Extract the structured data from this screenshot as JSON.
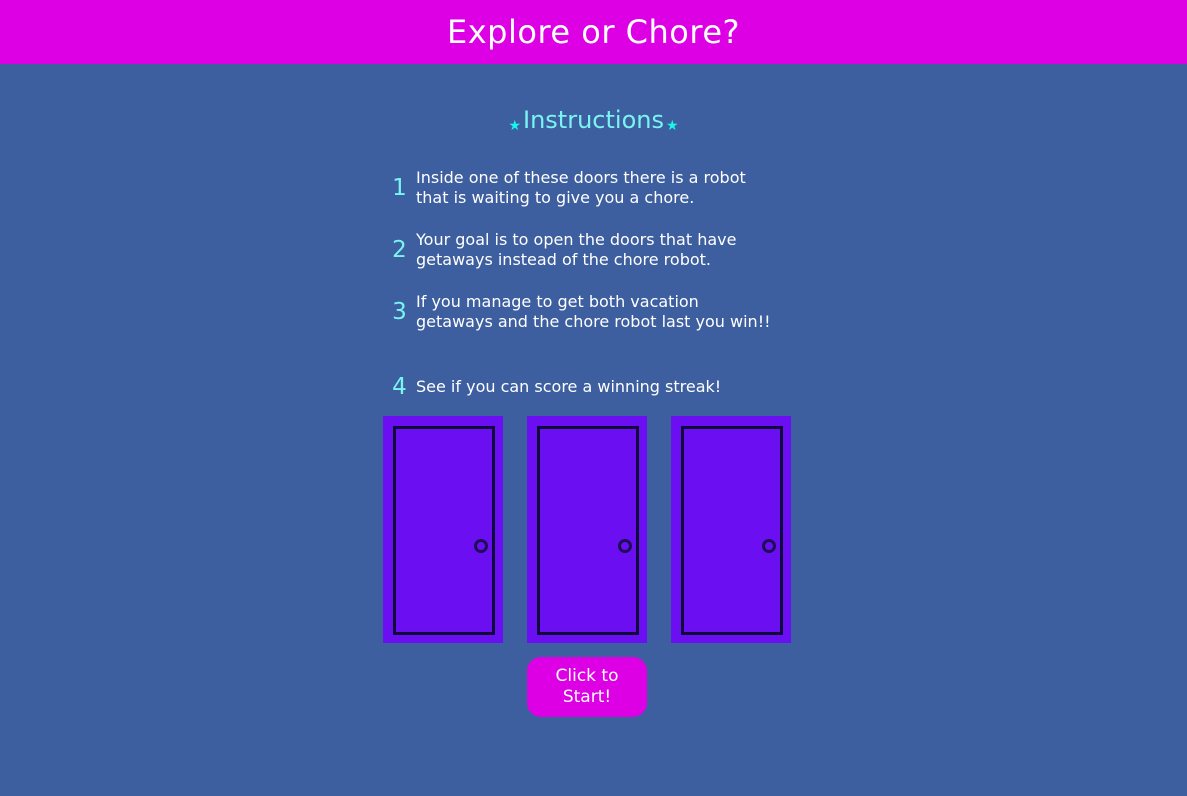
{
  "header": {
    "title": "Explore or Chore?"
  },
  "instructions": {
    "heading": "Instructions",
    "steps": [
      {
        "number": "1",
        "text": "Inside one of these doors there is a robot that is waiting to give you a chore."
      },
      {
        "number": "2",
        "text": "Your goal is to open the doors that have getaways instead of the chore robot."
      },
      {
        "number": "3",
        "text": "If you manage to get both vacation getaways and the chore robot last you win!!"
      },
      {
        "number": "4",
        "text": "See if you can score a winning streak!"
      }
    ]
  },
  "doors": [
    {
      "icon": "door-icon"
    },
    {
      "icon": "door-icon"
    },
    {
      "icon": "door-icon"
    }
  ],
  "start_button": {
    "label": "Click to Start!"
  },
  "colors": {
    "background": "#3d5fa0",
    "header": "#dd00e5",
    "accent_cyan": "#7af4f1",
    "door": "#6b0ff2",
    "button": "#dd00e5"
  }
}
